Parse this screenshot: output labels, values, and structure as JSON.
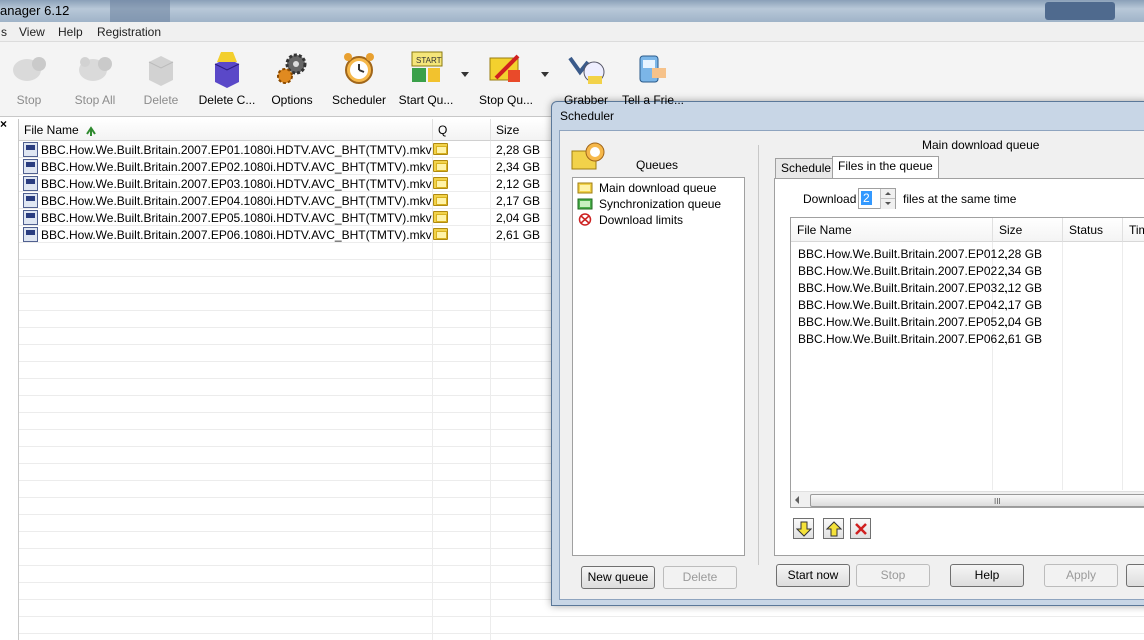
{
  "window": {
    "title": "anager 6.12"
  },
  "menu": [
    "s",
    "View",
    "Help",
    "Registration"
  ],
  "toolbar": [
    {
      "label": "Stop",
      "icon": "stop-icon",
      "disabled": true
    },
    {
      "label": "Stop All",
      "icon": "stop-all-icon",
      "disabled": true
    },
    {
      "label": "Delete",
      "icon": "delete-icon",
      "disabled": true
    },
    {
      "label": "Delete C...",
      "icon": "delete-completed-icon",
      "disabled": false
    },
    {
      "label": "Options",
      "icon": "gear-icon",
      "disabled": false
    },
    {
      "label": "Scheduler",
      "icon": "alarm-clock-icon",
      "disabled": false
    },
    {
      "label": "Start Qu...",
      "icon": "start-queue-icon",
      "disabled": false
    },
    {
      "label": "Stop Qu...",
      "icon": "stop-queue-icon",
      "disabled": false
    },
    {
      "label": "Grabber",
      "icon": "grabber-icon",
      "disabled": false
    },
    {
      "label": "Tell a Frie...",
      "icon": "tell-a-friend-icon",
      "disabled": false
    }
  ],
  "main_list": {
    "close_glyph": "×",
    "columns": {
      "file_name": "File Name",
      "q": "Q",
      "size": "Size"
    },
    "rows": [
      {
        "name": "BBC.How.We.Built.Britain.2007.EP01.1080i.HDTV.AVC_BHT(TMTV).mkv",
        "size": "2,28  GB"
      },
      {
        "name": "BBC.How.We.Built.Britain.2007.EP02.1080i.HDTV.AVC_BHT(TMTV).mkv",
        "size": "2,34  GB"
      },
      {
        "name": "BBC.How.We.Built.Britain.2007.EP03.1080i.HDTV.AVC_BHT(TMTV).mkv",
        "size": "2,12  GB"
      },
      {
        "name": "BBC.How.We.Built.Britain.2007.EP04.1080i.HDTV.AVC_BHT(TMTV).mkv",
        "size": "2,17  GB"
      },
      {
        "name": "BBC.How.We.Built.Britain.2007.EP05.1080i.HDTV.AVC_BHT(TMTV).mkv",
        "size": "2,04  GB"
      },
      {
        "name": "BBC.How.We.Built.Britain.2007.EP06.1080i.HDTV.AVC_BHT(TMTV).mkv",
        "size": "2,61  GB"
      }
    ]
  },
  "scheduler": {
    "title": "Scheduler",
    "queues_label": "Queues",
    "queues": [
      {
        "label": "Main download queue",
        "icon": "queue-folder-icon"
      },
      {
        "label": "Synchronization queue",
        "icon": "sync-queue-icon"
      },
      {
        "label": "Download limits",
        "icon": "download-limits-icon"
      }
    ],
    "new_queue_button": "New queue",
    "delete_button": "Delete",
    "panel_title": "Main download queue",
    "tabs": [
      "Schedule",
      "Files in the queue"
    ],
    "active_tab": "Files in the queue",
    "download_label": "Download",
    "simultaneous_value": "2",
    "files_same_time_label": "files at the same time",
    "columns": {
      "file_name": "File Name",
      "size": "Size",
      "status": "Status",
      "time": "Time"
    },
    "files": [
      {
        "name": "BBC.How.We.Built.Britain.2007.EP01....",
        "size": "2,28  GB"
      },
      {
        "name": "BBC.How.We.Built.Britain.2007.EP02....",
        "size": "2,34  GB"
      },
      {
        "name": "BBC.How.We.Built.Britain.2007.EP03....",
        "size": "2,12  GB"
      },
      {
        "name": "BBC.How.We.Built.Britain.2007.EP04....",
        "size": "2,17  GB"
      },
      {
        "name": "BBC.How.We.Built.Britain.2007.EP05....",
        "size": "2,04  GB"
      },
      {
        "name": "BBC.How.We.Built.Britain.2007.EP06....",
        "size": "2,61  GB"
      }
    ],
    "scroll_grip": "III",
    "bottom_buttons": {
      "start_now": "Start now",
      "stop": "Stop",
      "help": "Help",
      "apply": "Apply"
    }
  },
  "colors": {
    "accent": "#3399ff",
    "dialog_frame": "#c8d6e6"
  }
}
